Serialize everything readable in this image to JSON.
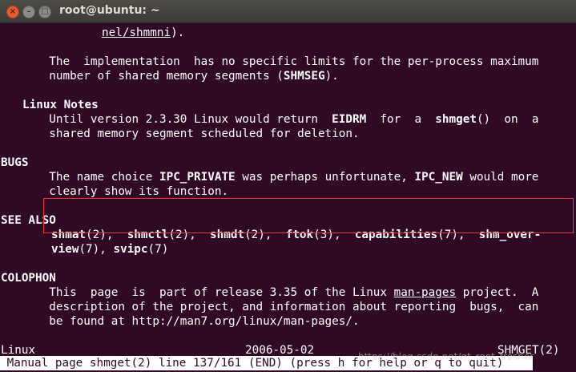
{
  "window": {
    "title": "root@ubuntu: ~",
    "close_glyph": "×",
    "min_glyph": "–",
    "max_glyph": "□"
  },
  "lines": {
    "l1": "nel/shmmni",
    "l1b": ").",
    "l2": "       The  implementation  has no specific limits for the per-process maximum",
    "l3a": "       number of shared memory segments (",
    "l3b": "SHMSEG",
    "l3c": ").",
    "l4": "Linux Notes",
    "l5a": "       Until version 2.3.30 Linux would return  ",
    "l5b": "EIDRM",
    "l5c": "  for  a  ",
    "l5d": "shmget",
    "l5e": "()  on  a",
    "l6": "       shared memory segment scheduled for deletion.",
    "l7": "BUGS",
    "l8a": "       The name choice ",
    "l8b": "IPC_PRIVATE",
    "l8c": " was perhaps unfortunate, ",
    "l8d": "IPC_NEW",
    "l8e": " would more",
    "l9": "       clearly show its function.",
    "l10": "SEE ALSO",
    "sa1": "shmat",
    "sa1s": "(2),  ",
    "sa2": "shmctl",
    "sa2s": "(2),  ",
    "sa3": "shmdt",
    "sa3s": "(2),  ",
    "sa4": "ftok",
    "sa4s": "(3),  ",
    "sa5": "capabilities",
    "sa5s": "(7),  ",
    "sa6": "shm_over-",
    "sa7": "view",
    "sa7s": "(7), ",
    "sa8": "svipc",
    "sa8s": "(7)",
    "l11": "COLOPHON",
    "l12a": "       This  page  is  part of release 3.35 of the Linux ",
    "l12b": "man-pages",
    "l12c": " project.  A",
    "l13": "       description of the project, and information about reporting  bugs,  can",
    "l14": "       be found at http://man7.org/linux/man-pages/.",
    "footer_left": "Linux",
    "footer_mid": "2006-05-02",
    "footer_right": "SHMGET(2)"
  },
  "status_line": " Manual page shmget(2) line 137/161 (END) (press h for help or q to quit)",
  "watermark": "https://blog.csdn.net/qt_root_fresher",
  "colors": {
    "background": "#300a24",
    "text": "#ffffff",
    "highlight_box": "#e53935"
  }
}
